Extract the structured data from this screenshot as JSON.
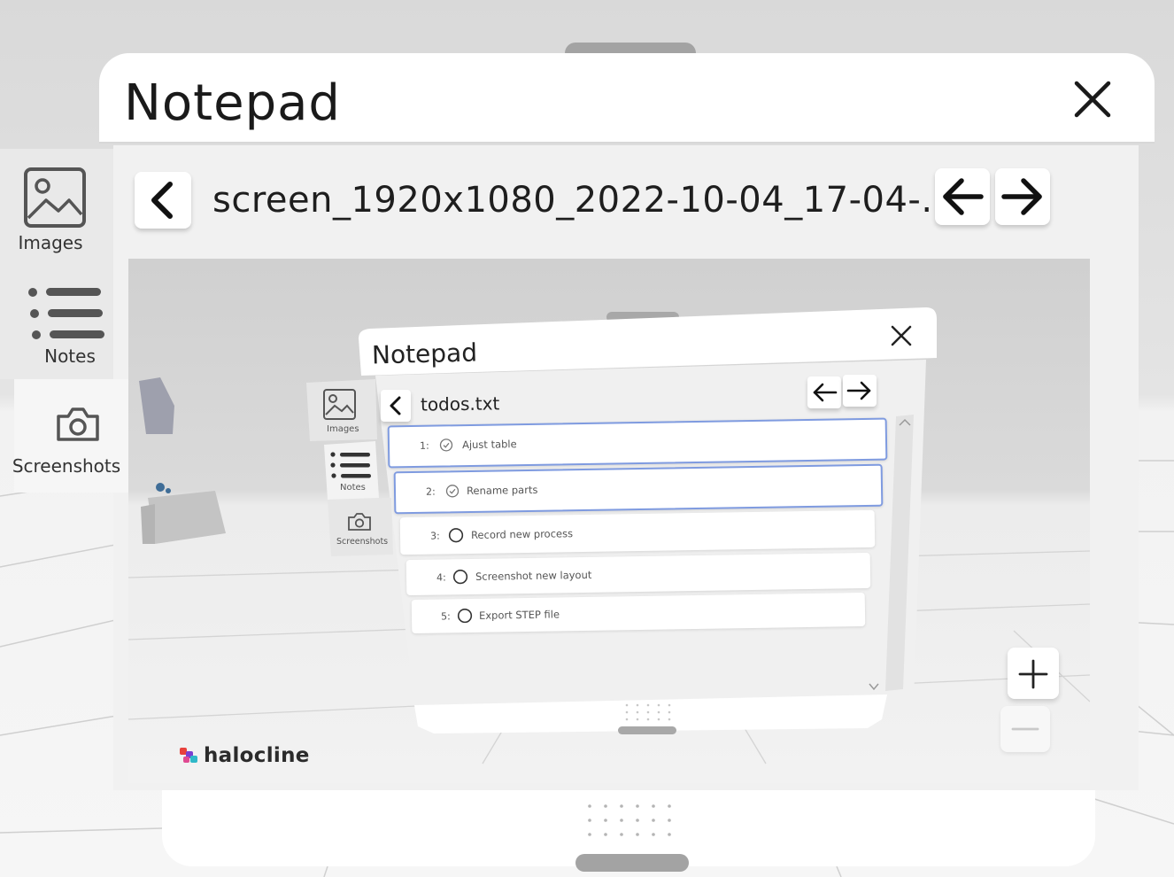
{
  "window": {
    "title": "Notepad",
    "close_icon": "close-icon"
  },
  "sidebar": {
    "items": [
      {
        "label": "Images",
        "icon": "image-icon"
      },
      {
        "label": "Notes",
        "icon": "list-icon"
      },
      {
        "label": "Screenshots",
        "icon": "camera-icon"
      }
    ]
  },
  "toolbar": {
    "back_icon": "chevron-left-icon",
    "filename": "screen_1920x1080_2022-10-04_17-04-...",
    "prev_icon": "arrow-left-icon",
    "next_icon": "arrow-right-icon"
  },
  "viewer": {
    "brand": "halocline",
    "zoom_in_icon": "plus-icon",
    "zoom_out_icon": "minus-icon"
  },
  "inner_window": {
    "title": "Notepad",
    "filename": "todos.txt",
    "sidebar": [
      "Images",
      "Notes",
      "Screenshots"
    ],
    "todos": [
      {
        "num": "1:",
        "text": "Ajust table",
        "done": true
      },
      {
        "num": "2:",
        "text": "Rename parts",
        "done": true
      },
      {
        "num": "3:",
        "text": "Record new process",
        "done": false
      },
      {
        "num": "4:",
        "text": "Screenshot new layout",
        "done": false
      },
      {
        "num": "5:",
        "text": "Export STEP file",
        "done": false
      }
    ]
  }
}
